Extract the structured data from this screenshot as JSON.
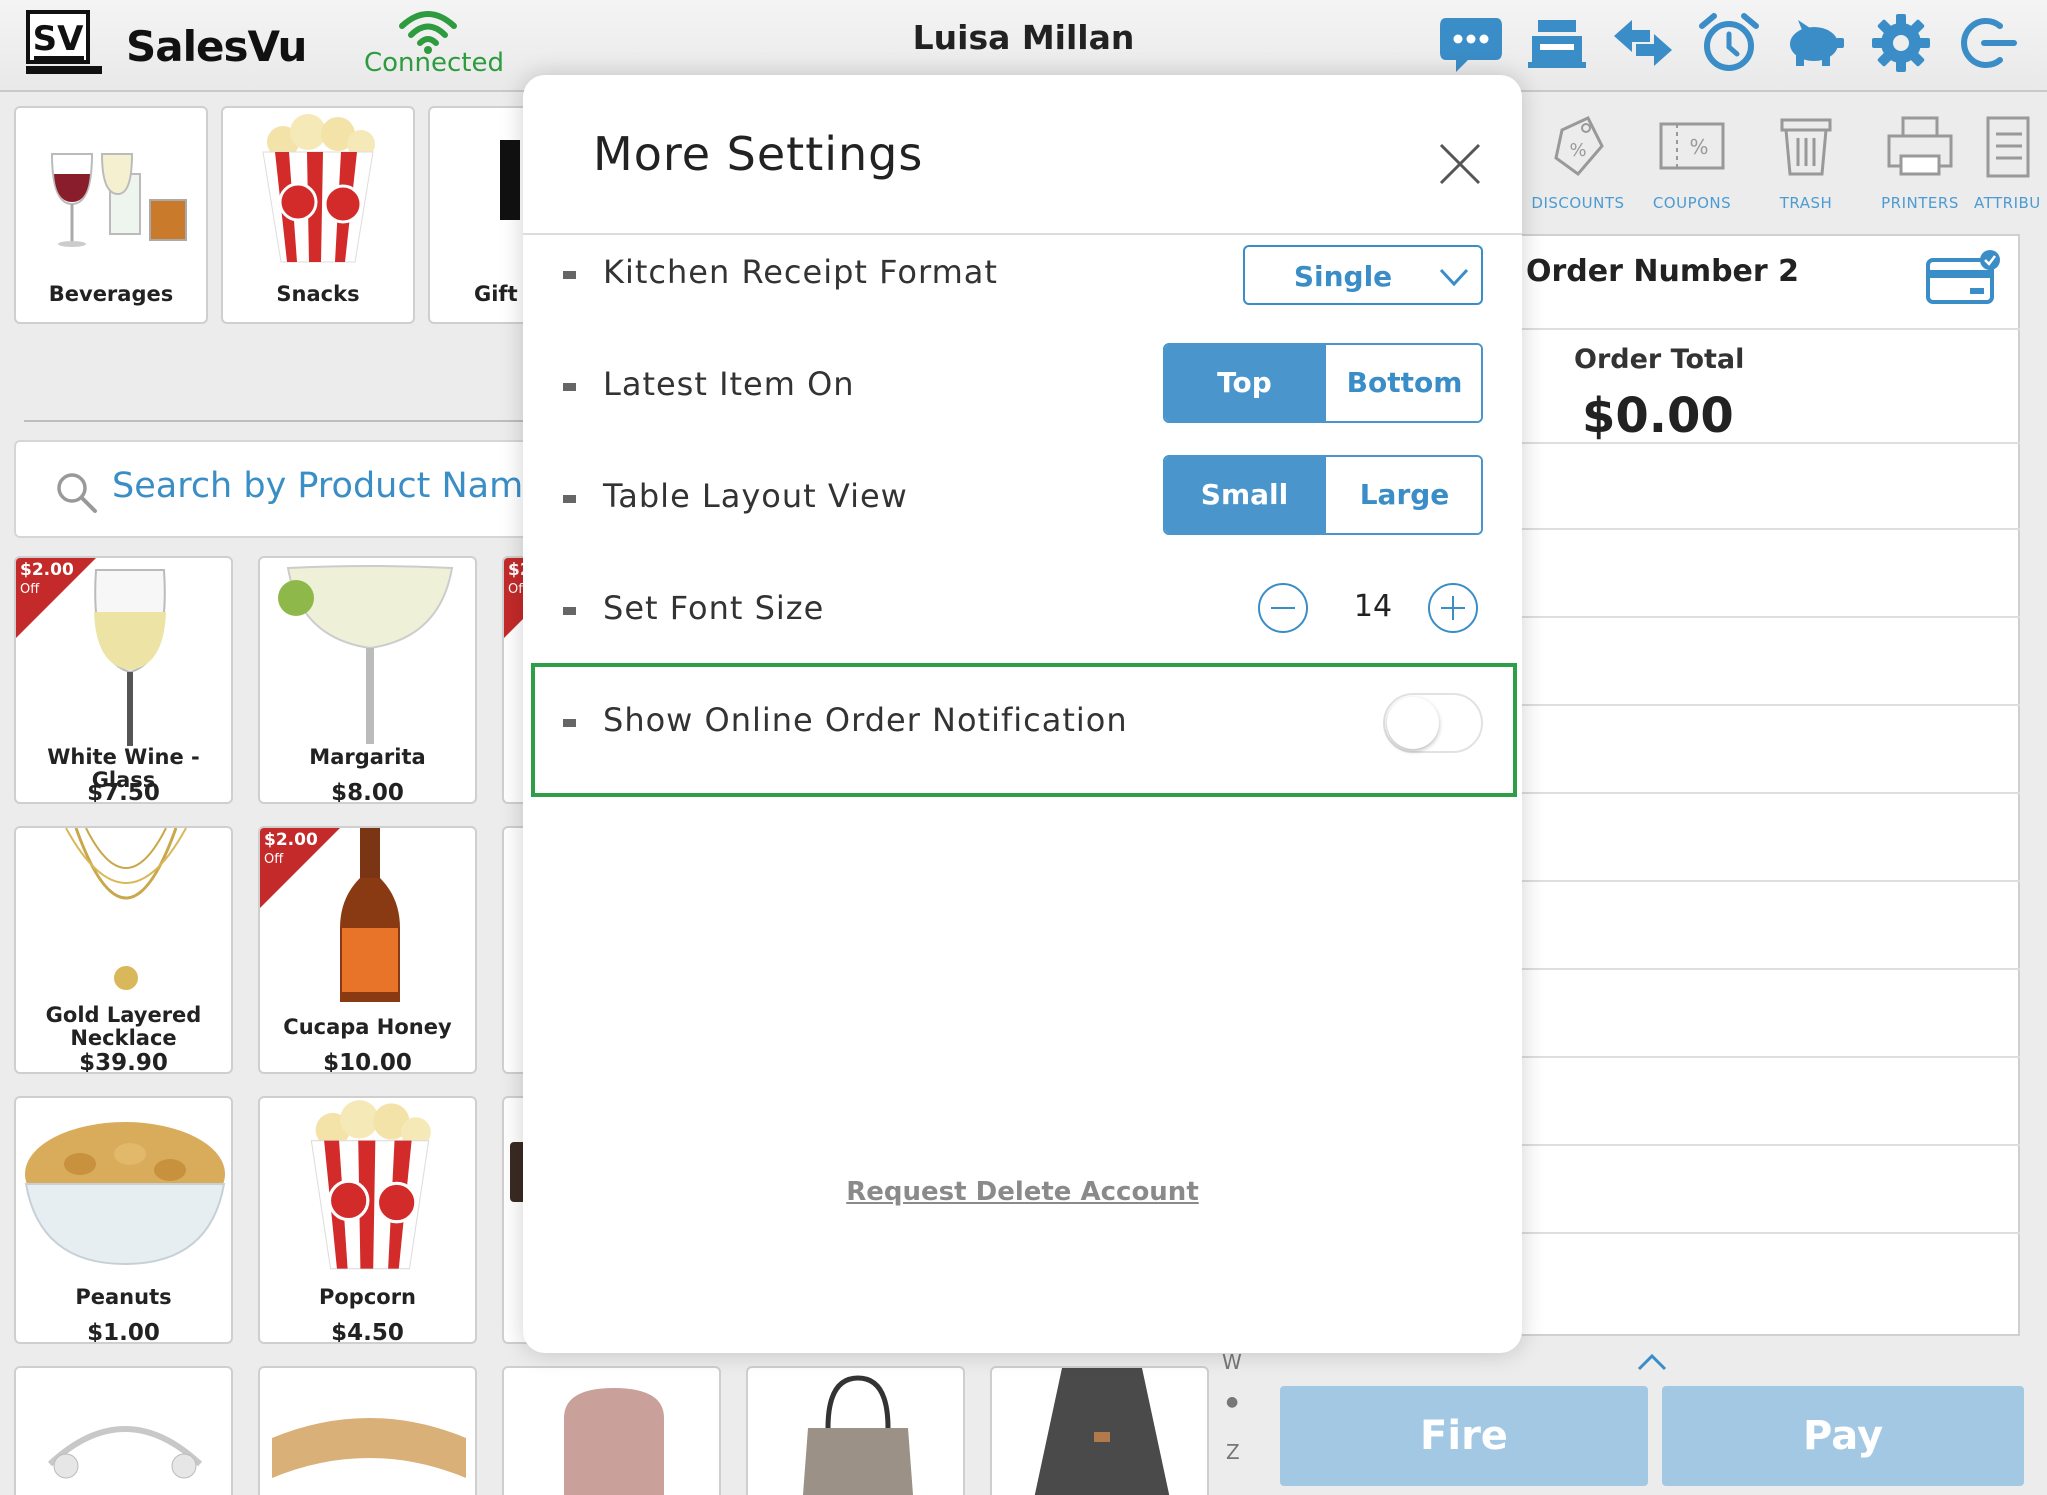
{
  "header": {
    "logo_text": "SV",
    "brand": "SalesVu",
    "connection_status": "Connected",
    "user_name": "Luisa Millan",
    "icons": [
      "chat-icon",
      "register-icon",
      "transfer-icon",
      "alarm-icon",
      "piggy-bank-icon",
      "gear-icon",
      "logout-icon"
    ]
  },
  "categories": [
    {
      "label": "Beverages"
    },
    {
      "label": "Snacks"
    },
    {
      "label": "Gift Cards"
    }
  ],
  "search": {
    "placeholder": "Search by Product Name"
  },
  "products": [
    {
      "name": "White Wine - Glass",
      "price": "$7.50",
      "discount": "$2.00",
      "off": "Off"
    },
    {
      "name": "Margarita",
      "price": "$8.00"
    },
    {
      "name": "Gold Layered Necklace",
      "price": "$39.90"
    },
    {
      "name": "Cucapa Honey",
      "price": "$10.00",
      "discount": "$2.00",
      "off": "Off"
    },
    {
      "name": "Peanuts",
      "price": "$1.00"
    },
    {
      "name": "Popcorn",
      "price": "$4.50"
    },
    {
      "partial_discount": "$2",
      "partial_off": "Off"
    }
  ],
  "index_letters": {
    "top": "W",
    "dot": "●",
    "bottom": "Z"
  },
  "right_toolbar": [
    {
      "label": "DISCOUNTS",
      "icon": "discount-tag-icon"
    },
    {
      "label": "COUPONS",
      "icon": "coupon-icon"
    },
    {
      "label": "TRASH",
      "icon": "trash-icon"
    },
    {
      "label": "PRINTERS",
      "icon": "printer-icon"
    },
    {
      "label": "ATTRIBU",
      "icon": "attributes-icon"
    }
  ],
  "order": {
    "number": "Order Number 2",
    "total_label": "Order Total",
    "total": "$0.00",
    "fire_label": "Fire",
    "pay_label": "Pay"
  },
  "modal": {
    "title": "More Settings",
    "kitchen_receipt": {
      "label": "Kitchen Receipt Format",
      "value": "Single"
    },
    "latest_item": {
      "label": "Latest Item On",
      "options": [
        "Top",
        "Bottom"
      ],
      "selected": "Top"
    },
    "table_layout": {
      "label": "Table Layout View",
      "options": [
        "Small",
        "Large"
      ],
      "selected": "Small"
    },
    "font_size": {
      "label": "Set Font Size",
      "value": "14"
    },
    "online_notification": {
      "label": "Show Online Order Notification",
      "enabled": false
    },
    "delete_account": "Request Delete Account"
  },
  "colors": {
    "accent": "#4a96cc",
    "connected": "#2e9b3e",
    "highlight": "#2f9e48",
    "discount": "#c42a2a",
    "action_button": "#a3c8e4"
  }
}
